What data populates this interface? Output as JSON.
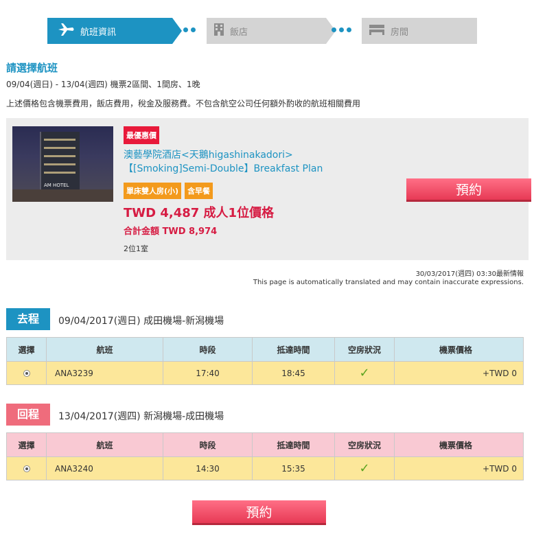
{
  "steps": [
    {
      "label": "航班資訊",
      "icon": "airplane-icon",
      "active": true
    },
    {
      "label": "飯店",
      "icon": "building-icon",
      "active": false
    },
    {
      "label": "房間",
      "icon": "bed-icon",
      "active": false
    }
  ],
  "page_title": "請選擇航班",
  "dates_line": "09/04(週日) - 13/04(週四) 機票2區間、1間房、1晚",
  "notice": "上述價格包含機票費用，飯店費用，稅金及服務費。不包含航空公司任何額外酌收的航班相關費用",
  "hotel": {
    "badge": "最優惠價",
    "name_line1": "澳藝學院酒店<天鵝higashinakadori>",
    "name_line2": "【[Smoking]Semi-Double】Breakfast Plan",
    "tags": [
      "單床雙人房(小)",
      "含早餐"
    ],
    "price_main": "TWD 4,487 成人1位價格",
    "price_total": "合計金額 TWD 8,974",
    "rooms": "2位1室",
    "photo_sign": "AM HOTEL",
    "book_label": "預約"
  },
  "updated": "30/03/2017(週四) 03:30最新情報",
  "translated_note": "This page is automatically translated and may contain inaccurate expressions.",
  "outbound": {
    "badge": "去程",
    "info": "09/04/2017(週日) 成田機場-新潟機場",
    "headers": [
      "選擇",
      "航班",
      "時段",
      "抵達時間",
      "空房狀況",
      "機票價格"
    ],
    "row": {
      "flight": "ANA3239",
      "time": "17:40",
      "arrival": "18:45",
      "price": "+TWD 0"
    }
  },
  "return": {
    "badge": "回程",
    "info": "13/04/2017(週四) 新潟機場-成田機場",
    "headers": [
      "選擇",
      "航班",
      "時段",
      "抵達時間",
      "空房狀況",
      "機票價格"
    ],
    "row": {
      "flight": "ANA3240",
      "time": "14:30",
      "arrival": "15:35",
      "price": "+TWD 0"
    }
  },
  "book_label": "預約",
  "colors": {
    "primary": "#1d93c2",
    "accent": "#e73a55",
    "price": "#d61c43",
    "tag": "#f39a1c"
  }
}
